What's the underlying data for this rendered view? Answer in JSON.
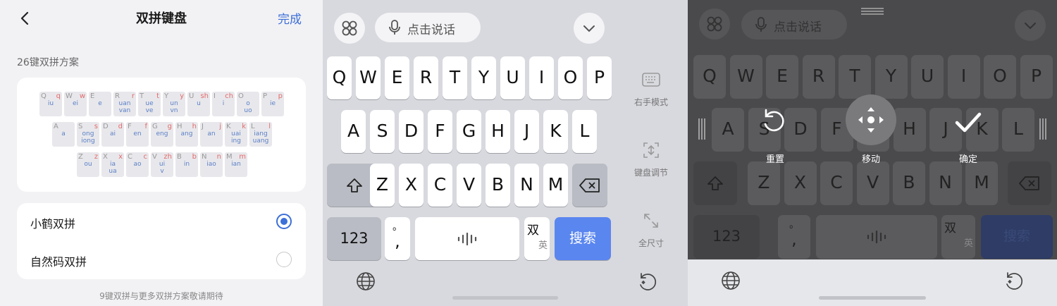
{
  "settings": {
    "title": "双拼键盘",
    "done": "完成",
    "section": "26键双拼方案",
    "rows": [
      [
        {
          "l": "Q",
          "a": "q",
          "b": "iu"
        },
        {
          "l": "W",
          "a": "w",
          "b": "ei"
        },
        {
          "l": "E",
          "a": "",
          "b": "e"
        },
        {
          "l": "R",
          "a": "r",
          "b": "uan\nvan"
        },
        {
          "l": "T",
          "a": "t",
          "b": "ue\nve"
        },
        {
          "l": "Y",
          "a": "y",
          "b": "un\nvn"
        },
        {
          "l": "U",
          "a": "sh",
          "b": "u"
        },
        {
          "l": "I",
          "a": "ch",
          "b": "i"
        },
        {
          "l": "O",
          "a": "",
          "b": "o\nuo"
        },
        {
          "l": "P",
          "a": "p",
          "b": "ie"
        }
      ],
      [
        {
          "l": "A",
          "a": "",
          "b": "a"
        },
        {
          "l": "S",
          "a": "s",
          "b": "ong\niong"
        },
        {
          "l": "D",
          "a": "d",
          "b": "ai"
        },
        {
          "l": "F",
          "a": "f",
          "b": "en"
        },
        {
          "l": "G",
          "a": "g",
          "b": "eng"
        },
        {
          "l": "H",
          "a": "h",
          "b": "ang"
        },
        {
          "l": "J",
          "a": "j",
          "b": "an"
        },
        {
          "l": "K",
          "a": "k",
          "b": "uai\ning"
        },
        {
          "l": "L",
          "a": "l",
          "b": "iang\nuang"
        }
      ],
      [
        {
          "l": "Z",
          "a": "z",
          "b": "ou"
        },
        {
          "l": "X",
          "a": "x",
          "b": "ia\nua"
        },
        {
          "l": "C",
          "a": "c",
          "b": "ao"
        },
        {
          "l": "V",
          "a": "zh",
          "b": "ui\nv"
        },
        {
          "l": "B",
          "a": "b",
          "b": "in"
        },
        {
          "l": "N",
          "a": "n",
          "b": "iao"
        },
        {
          "l": "M",
          "a": "m",
          "b": "ian"
        }
      ]
    ],
    "options": [
      {
        "label": "小鹤双拼",
        "selected": true
      },
      {
        "label": "自然码双拼",
        "selected": false
      }
    ],
    "footnote": "9键双拼与更多双拼方案敬请期待"
  },
  "keyboard": {
    "voice": "点击说话",
    "row1": [
      "Q",
      "W",
      "E",
      "R",
      "T",
      "Y",
      "U",
      "I",
      "O",
      "P"
    ],
    "row2": [
      "A",
      "S",
      "D",
      "F",
      "G",
      "H",
      "J",
      "K",
      "L"
    ],
    "row3": [
      "Z",
      "X",
      "C",
      "V",
      "B",
      "N",
      "M"
    ],
    "num": "123",
    "punct_top": "。",
    "punct_bottom": ",",
    "lang_a": "双",
    "lang_b": "英",
    "search": "搜索",
    "side_tools": [
      "右手模式",
      "键盘调节",
      "全尺寸"
    ]
  },
  "overlay": {
    "reset": "重置",
    "move": "移动",
    "confirm": "确定"
  },
  "colors": {
    "accent": "#3d6fd8",
    "search_key": "#5a86f0"
  }
}
